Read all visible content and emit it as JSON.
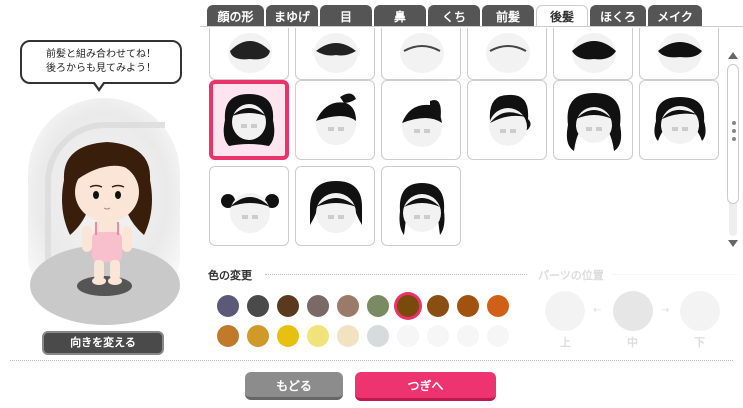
{
  "tabs": [
    {
      "label": "顔の形",
      "active": false
    },
    {
      "label": "まゆげ",
      "active": false
    },
    {
      "label": "目",
      "active": false
    },
    {
      "label": "鼻",
      "active": false
    },
    {
      "label": "くち",
      "active": false
    },
    {
      "label": "前髪",
      "active": false
    },
    {
      "label": "後髪",
      "active": true
    },
    {
      "label": "ほくろ",
      "active": false
    },
    {
      "label": "メイク",
      "active": false
    }
  ],
  "speech": {
    "line1": "前髪と組み合わせてね！",
    "line2": "後ろからも見てみよう！"
  },
  "turn_button": "向きを変える",
  "hair_options": {
    "count_visible": 15,
    "selected_index": 0
  },
  "color_section": {
    "label": "色の変更",
    "swatches": [
      "#5a5a78",
      "#4a4a4a",
      "#5a3a1e",
      "#7a6a66",
      "#9a7a68",
      "#7a8a62",
      "#7a4a0a",
      "#8a4e12",
      "#a0520e",
      "#d06018",
      "#c07a2a",
      "#d09a2a",
      "#e6c010",
      "#f2e27a",
      "#f2e2c0",
      "#d6dcdc"
    ],
    "selected_index": 6
  },
  "parts_position": {
    "label": "パーツの位置",
    "up": "上",
    "middle": "中",
    "down": "下"
  },
  "footer": {
    "back": "もどる",
    "next": "つぎへ"
  },
  "colors": {
    "accent": "#ee3470",
    "tab_bg": "#555555"
  }
}
